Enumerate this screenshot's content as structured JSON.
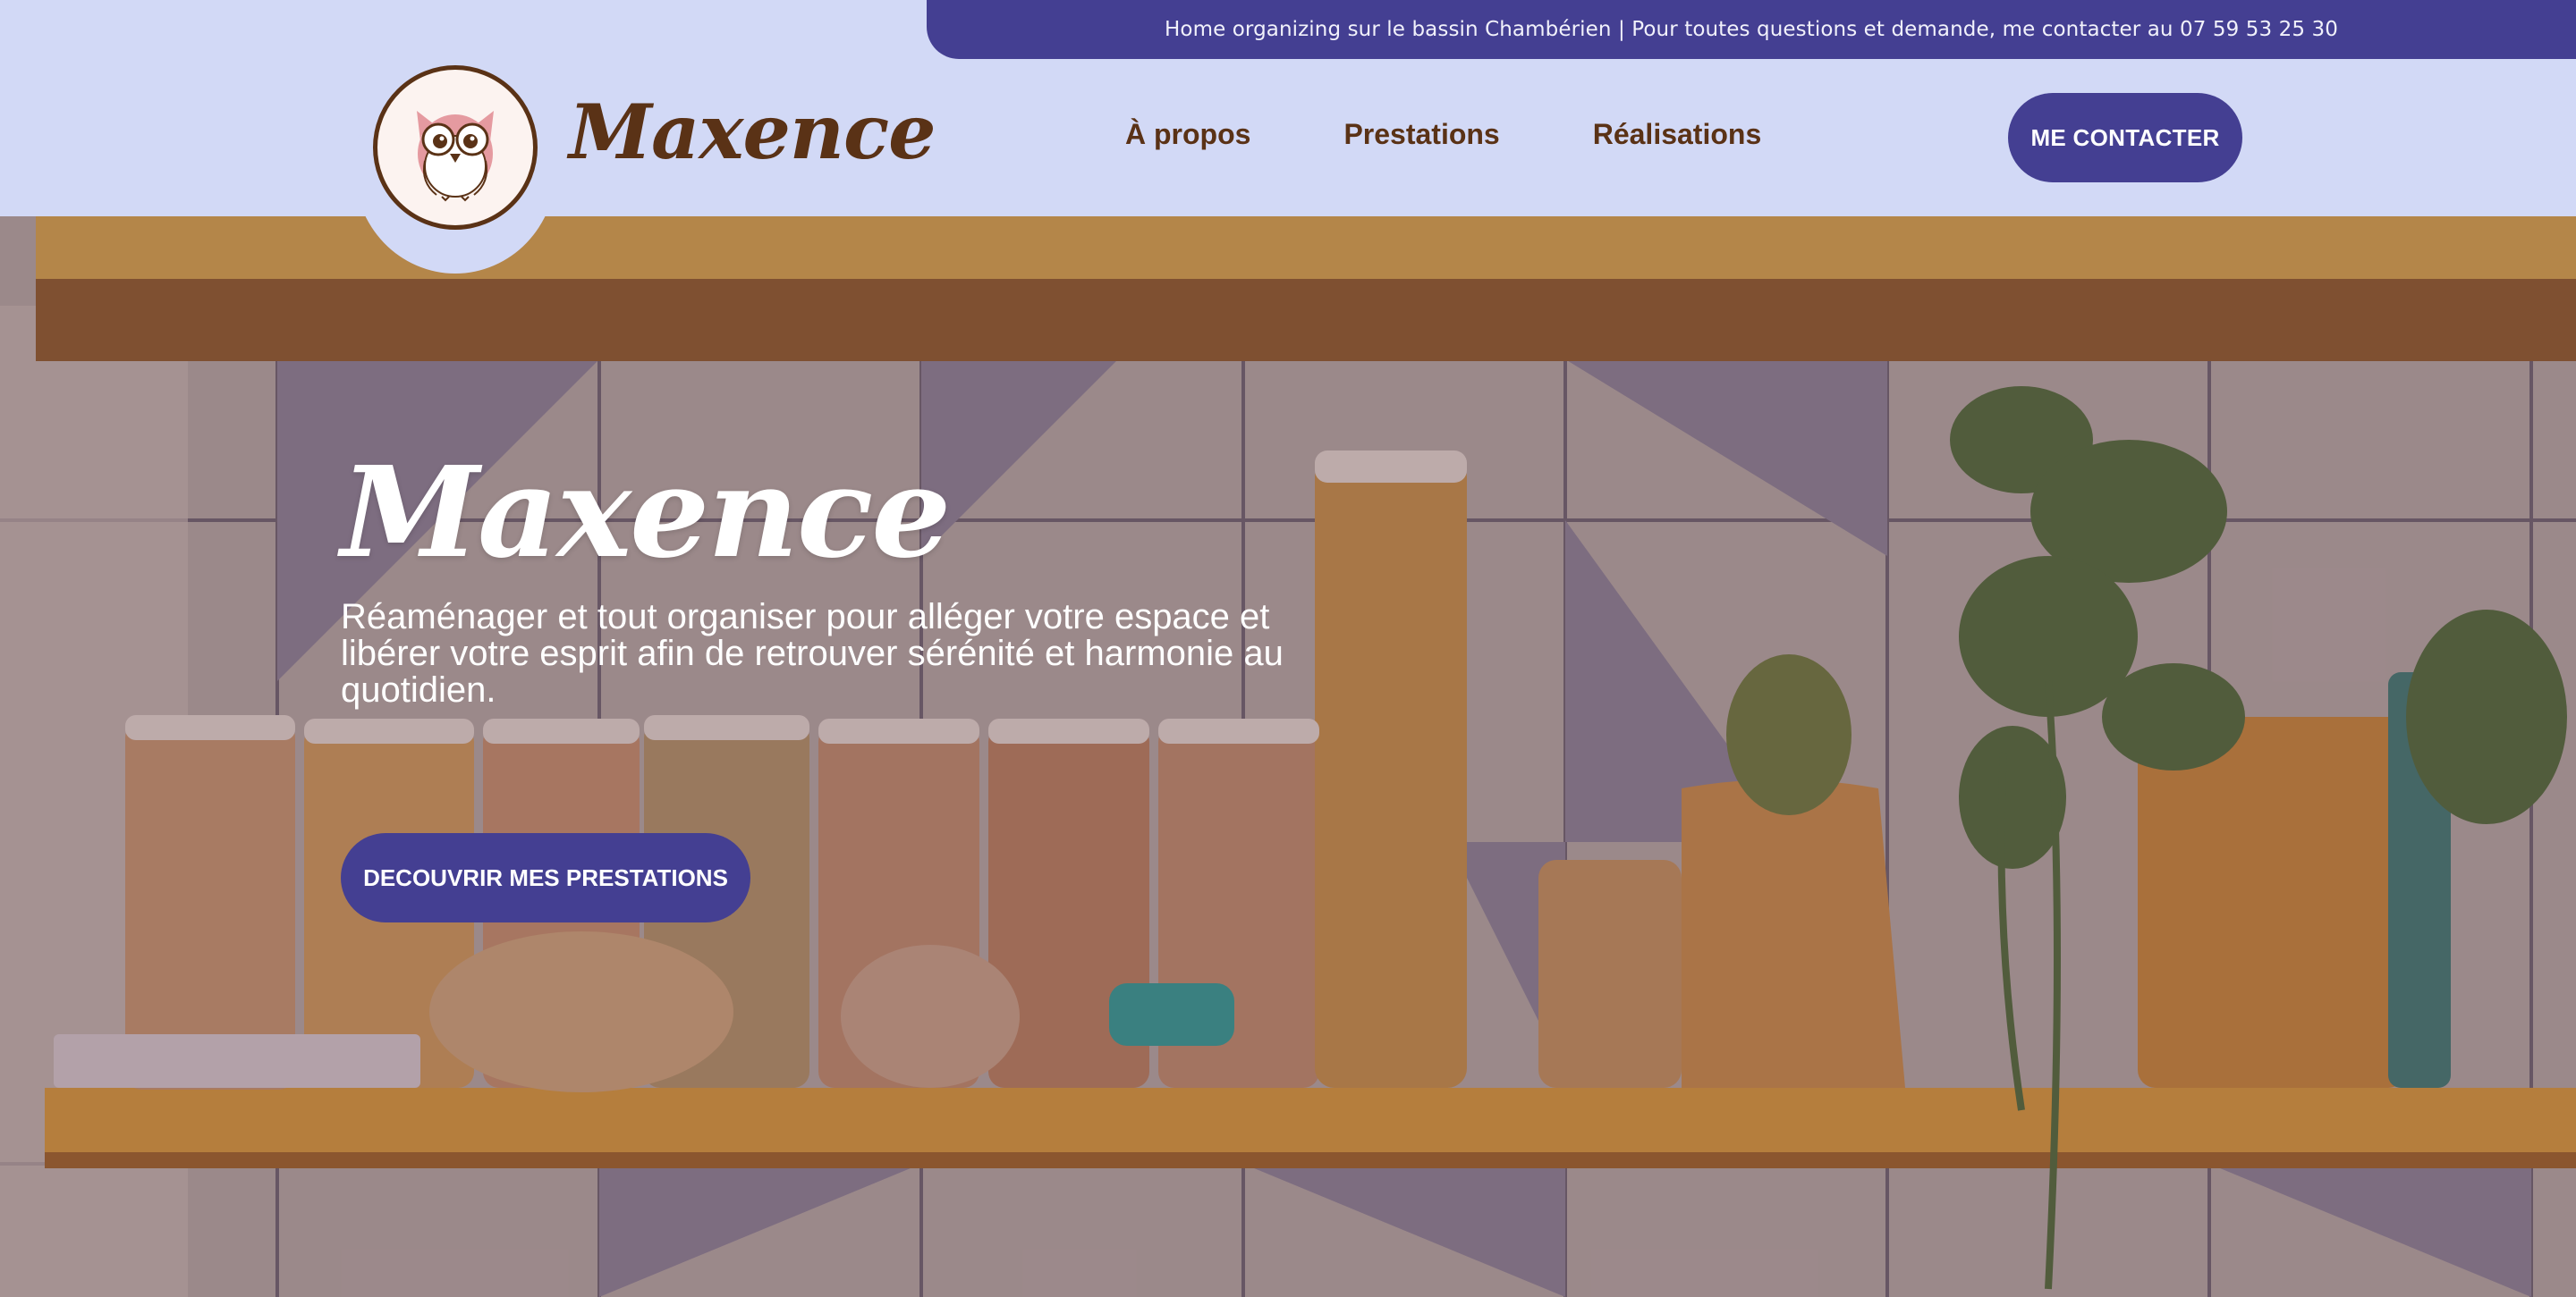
{
  "topbar": {
    "text": "Home organizing sur le bassin Chambérien | Pour toutes questions et demande, me contacter au 07 59 53 25 30"
  },
  "header": {
    "brand": "Maxence",
    "logo_icon": "owl-icon",
    "nav": [
      {
        "label": "À propos"
      },
      {
        "label": "Prestations"
      },
      {
        "label": "Réalisations"
      }
    ],
    "contact_label": "ME CONTACTER"
  },
  "hero": {
    "title": "Maxence",
    "subtitle": "Réaménager et tout organiser pour alléger votre espace et libérer votre esprit afin de retrouver sérénité et harmonie au quotidien.",
    "cta_label": "DECOUVRIR MES PRESTATIONS",
    "background": "kitchen-shelf-jars-photo"
  },
  "colors": {
    "accent": "#443f92",
    "brown": "#5a3216",
    "header_bg": "#d2d9f6"
  }
}
